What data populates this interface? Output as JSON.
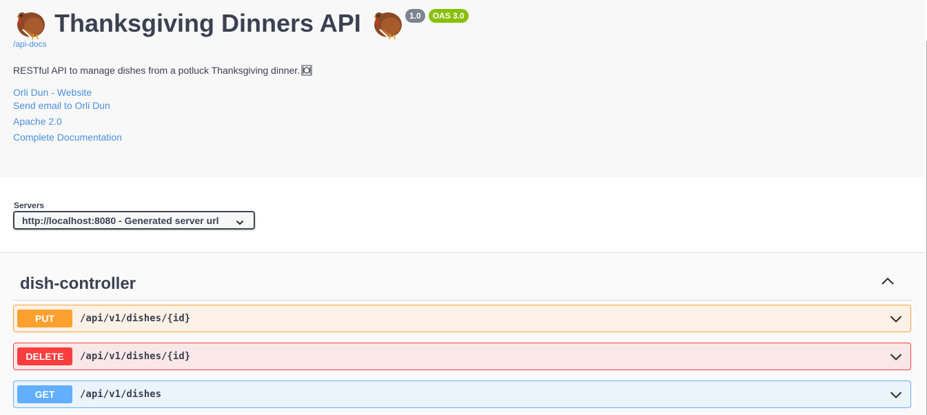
{
  "info": {
    "title": "Thanksgiving Dinners API",
    "title_icon_left": "turkey-icon",
    "title_icon_right": "turkey-icon",
    "version_badge": "1.0",
    "oas_badge": "OAS 3.0",
    "api_docs_link": "/api-docs",
    "description": "RESTful API to manage dishes from a potluck Thanksgiving dinner.",
    "description_icon": "plate-with-cutlery-icon",
    "links": [
      "Orli Dun - Website",
      "Send email to Orli Dun",
      "Apache 2.0",
      "Complete Documentation"
    ]
  },
  "servers": {
    "label": "Servers",
    "selected": "http://localhost:8080 - Generated server url"
  },
  "tag": {
    "name": "dish-controller",
    "toggle_icon": "chevron-up-icon",
    "operations": [
      {
        "method": "PUT",
        "path": "/api/v1/dishes/{id}",
        "color": "#fca130"
      },
      {
        "method": "DELETE",
        "path": "/api/v1/dishes/{id}",
        "color": "#f93e3e"
      },
      {
        "method": "GET",
        "path": "/api/v1/dishes",
        "color": "#61affe"
      }
    ]
  },
  "colors": {
    "link": "#4990e2",
    "text": "#3b4151",
    "version_badge": "#7d8492",
    "oas_badge": "#89bf04"
  }
}
